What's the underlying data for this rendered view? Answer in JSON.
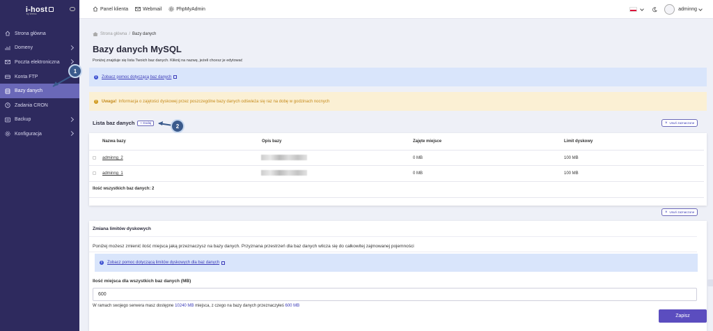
{
  "brand": {
    "name": "i-host",
    "sub": "by Webio"
  },
  "sidebar": {
    "items": [
      {
        "label": "Strona główna",
        "icon": "home-icon",
        "chevron": false,
        "active": false
      },
      {
        "label": "Domeny",
        "icon": "domain-icon",
        "chevron": true,
        "active": false
      },
      {
        "label": "Poczta elektroniczna",
        "icon": "mail-icon",
        "chevron": true,
        "active": false
      },
      {
        "label": "Konta FTP",
        "icon": "ftp-icon",
        "chevron": false,
        "active": false
      },
      {
        "label": "Bazy danych",
        "icon": "database-icon",
        "chevron": false,
        "active": true
      },
      {
        "label": "Zadania CRON",
        "icon": "clock-icon",
        "chevron": false,
        "active": false
      },
      {
        "label": "Backup",
        "icon": "backup-icon",
        "chevron": true,
        "active": false
      },
      {
        "label": "Konfiguracja",
        "icon": "gear-icon",
        "chevron": true,
        "active": false
      }
    ]
  },
  "topbar": {
    "links": [
      {
        "label": "Panel klienta",
        "icon": "home-icon"
      },
      {
        "label": "Webmail",
        "icon": "mail-icon"
      },
      {
        "label": "PhpMyAdmin",
        "icon": "gear-icon"
      }
    ],
    "user": "adminng"
  },
  "breadcrumb": {
    "home": "Strona główna",
    "sep": "/",
    "current": "Bazy danych"
  },
  "page": {
    "title": "Bazy danych MySQL",
    "description": "Poniżej znajduje się lista Twoich baz danych. Kliknij na nazwę, jeżeli chcesz je edytować"
  },
  "help_link": "Zobacz pomoc dotyczącą baz danych",
  "warning": {
    "bold": "Uwaga!",
    "text": "Informacja o zajętości dyskowej przez poszczególne bazy danych odświeża się raz na dobę w godzinach nocnych"
  },
  "list": {
    "title": "Lista baz danych",
    "add_label": "+ Dodaj",
    "delete_label": "Usuń zaznaczone",
    "columns": [
      "Nazwa bazy",
      "Opis bazy",
      "Zajęte miejsce",
      "Limit dyskowy"
    ],
    "rows": [
      {
        "name": "adminng_2",
        "used": "0 MB",
        "limit": "100 MB"
      },
      {
        "name": "adminng_1",
        "used": "0 MB",
        "limit": "100 MB"
      }
    ],
    "total": "Ilość wszystkich baz danych: 2"
  },
  "limits": {
    "title": "Zmiana limitów dyskowych",
    "description": "Poniżej możesz zmienić ilość miejsca jaką przeznaczysz na bazy danych. Przyznana przestrzeń dla baz danych wlicza się do całkowitej zajmowanej pojemności",
    "help_link": "Zobacz pomoc dotyczącą limitów dyskowych dla baz danych",
    "label": "Ilość miejsca dla wszystkich baz danych (MB)",
    "value": "600",
    "note_pre": "W ramach swojego serwera masz dostępne",
    "note_available": "10240 MB",
    "note_mid": "miejsca, z czego na bazy danych przeznaczyłeś",
    "note_used": "600 MB",
    "save_label": "Zapisz"
  },
  "markers": {
    "first": "1",
    "second": "2"
  },
  "colors": {
    "sidebar": "#2e2a5e",
    "active": "#6a68b8",
    "accent": "#5b4dbf",
    "info_bg": "#d9e5fb",
    "warn_bg": "#fbf0d4"
  }
}
